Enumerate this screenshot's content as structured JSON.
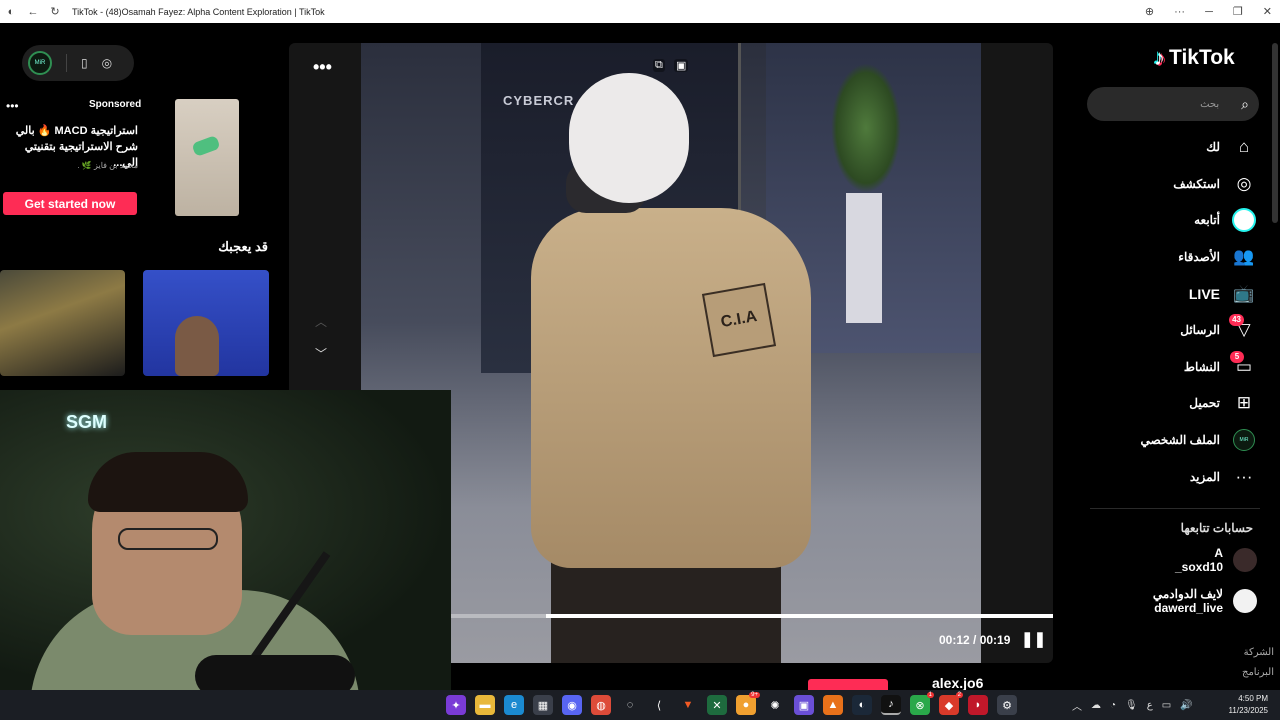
{
  "window": {
    "title": "TikTok - (48)Osamah Fayez: Alpha Content Exploration | TikTok",
    "controls": {
      "zoom": "⊕",
      "menu": "···",
      "minimize": "─",
      "restore": "❐",
      "close": "✕"
    }
  },
  "mini_player": {
    "avatar": "MiR"
  },
  "ad": {
    "sponsored_label": "Sponsored",
    "text": "استراتيجية MACD 🔥 بالي شرح الاستراتيجية بتقنيتي الي...",
    "author": "محمد بن فايز 🌿 .",
    "cta": "Get started now"
  },
  "you_may_like": "قد يعجبك",
  "webcam": {
    "logo": "SGM"
  },
  "video": {
    "sign_text": "CYBERCR",
    "patch_text": "C.I.A",
    "current_time": "00:12",
    "duration": "00:19",
    "time_display": "00:12 / 00:19",
    "progress": 0.16,
    "below_author": "alex.jo6"
  },
  "sidebar": {
    "logo": "TikTok",
    "search_placeholder": "بحث",
    "nav": [
      {
        "label": "لك",
        "icon": "home-icon"
      },
      {
        "label": "استكشف",
        "icon": "compass-icon"
      },
      {
        "label": "أتابعه",
        "icon": "following-avatar-icon"
      },
      {
        "label": "الأصدقاء",
        "icon": "friends-icon"
      },
      {
        "label": "LIVE",
        "icon": "live-tv-icon"
      },
      {
        "label": "الرسائل",
        "icon": "messages-icon",
        "badge": "43"
      },
      {
        "label": "النشاط",
        "icon": "activity-icon",
        "badge": "5"
      },
      {
        "label": "تحميل",
        "icon": "upload-icon"
      },
      {
        "label": "الملف الشخصي",
        "icon": "profile-avatar-icon"
      },
      {
        "label": "المزيد",
        "icon": "more-icon"
      }
    ],
    "following_title": "حسابات تتابعها",
    "following": [
      {
        "name": "A",
        "handle": "_soxd10"
      },
      {
        "name": "لايف الدوادمي",
        "handle": "dawerd_live"
      }
    ],
    "footer_links": [
      "الشركة",
      "البرنامج"
    ]
  },
  "taskbar": {
    "time": "4:50 PM",
    "date": "11/23/2025",
    "lang": "ع",
    "badges": {
      "app9": "9+",
      "whatsapp": "1",
      "app_red": "2"
    }
  },
  "colors": {
    "accent": "#fe2c55",
    "cyan": "#25f4ee",
    "bg": "#000000"
  }
}
